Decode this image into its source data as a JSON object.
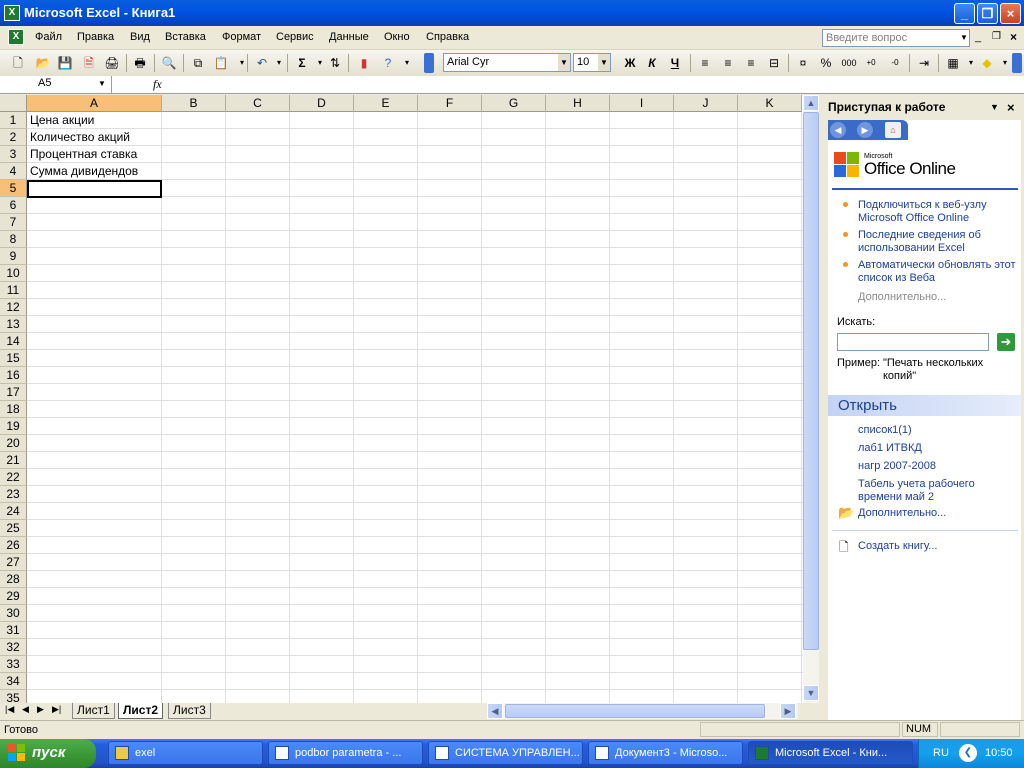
{
  "window": {
    "title": "Microsoft Excel - Книга1"
  },
  "menu": {
    "items": [
      "Файл",
      "Правка",
      "Вид",
      "Вставка",
      "Формат",
      "Сервис",
      "Данные",
      "Окно",
      "Справка"
    ],
    "question_placeholder": "Введите вопрос"
  },
  "toolbar": {
    "font": "Arial Cyr",
    "size": "10",
    "bold": "Ж",
    "italic": "К",
    "underline": "Ч",
    "sum": "Σ",
    "percent": "%",
    "thousands": "000"
  },
  "formula_bar": {
    "name_box": "A5",
    "fx": "fx",
    "value": ""
  },
  "grid": {
    "columns": [
      "A",
      "B",
      "C",
      "D",
      "E",
      "F",
      "G",
      "H",
      "I",
      "J",
      "K"
    ],
    "rows": [
      "1",
      "2",
      "3",
      "4",
      "5",
      "6",
      "7",
      "8",
      "9",
      "10",
      "11",
      "12",
      "13",
      "14",
      "15",
      "16",
      "17",
      "18",
      "19",
      "20",
      "21",
      "22",
      "23",
      "24",
      "25",
      "26",
      "27",
      "28",
      "29",
      "30",
      "31",
      "32",
      "33",
      "34",
      "35"
    ],
    "cells": {
      "A1": "Цена акции",
      "A2": "Количество акций",
      "A3": "Процентная ставка",
      "A4": "Сумма дивидендов"
    },
    "active_cell": "A5"
  },
  "sheets": {
    "tabs": [
      "Лист1",
      "Лист2",
      "Лист3"
    ],
    "active": "Лист2"
  },
  "task_pane": {
    "title": "Приступая к работе",
    "logo_small": "Microsoft",
    "logo_big": "Office Online",
    "links": [
      "Подключиться к веб-узлу Microsoft Office Online",
      "Последние сведения об использовании Excel",
      "Автоматически обновлять этот список из Веба"
    ],
    "more": "Дополнительно...",
    "search_label": "Искать:",
    "example_label": "Пример:",
    "example_text": "\"Печать нескольких копий\"",
    "open_title": "Открыть",
    "recent_files": [
      "список1(1)",
      "лаб1 ИТВКД",
      "нагр 2007-2008",
      "Табель учета рабочего времени май 2"
    ],
    "open_more": "Дополнительно...",
    "create": "Создать книгу..."
  },
  "status": {
    "text": "Готово",
    "num": "NUM"
  },
  "taskbar": {
    "start": "пуск",
    "tasks": [
      "exel",
      "podbor parametra - ...",
      "СИСТЕМА УПРАВЛЕН...",
      "Документ3 - Microso...",
      "Microsoft Excel - Кни..."
    ],
    "lang": "RU",
    "clock": "10:50"
  },
  "colors": {
    "accent": "#0054e3",
    "selected_header": "#f8c076",
    "link": "#1b3f9a",
    "start_green": "#3c9a38"
  }
}
